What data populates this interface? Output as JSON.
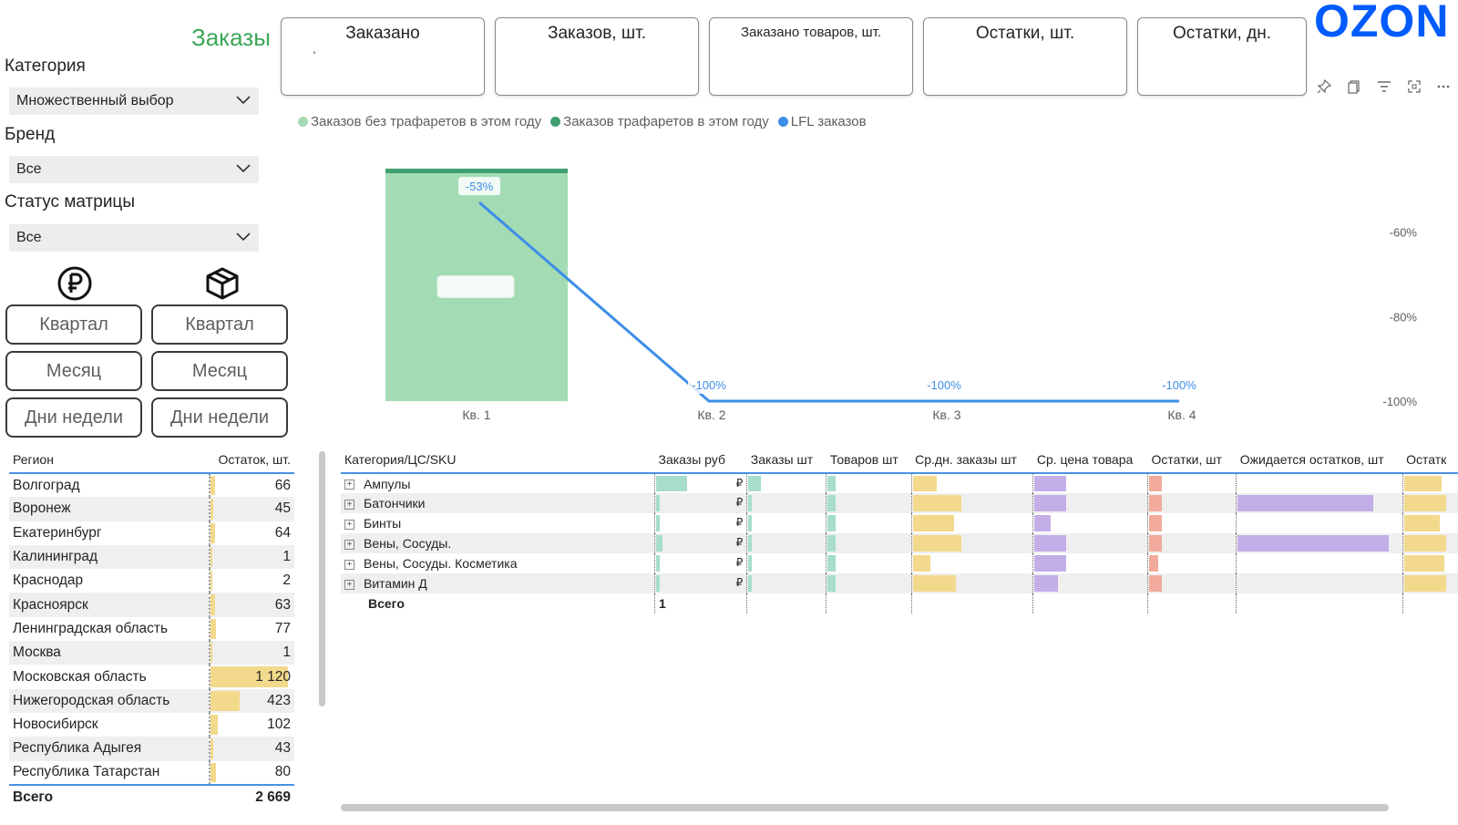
{
  "page_title": "Заказы",
  "brand_logo": "OZON",
  "filters": [
    {
      "label": "Категория",
      "value": "Множественный выбор"
    },
    {
      "label": "Бренд",
      "value": "Все"
    },
    {
      "label": "Статус матрицы",
      "value": "Все"
    }
  ],
  "toggle_icons": [
    "ruble-icon",
    "box-icon"
  ],
  "period_buttons": {
    "left": [
      "Квартал",
      "Месяц",
      "Дни недели"
    ],
    "right": [
      "Квартал",
      "Месяц",
      "Дни недели"
    ]
  },
  "kpi_cards": [
    "Заказано",
    "Заказов, шт.",
    "Заказано товаров, шт.",
    "Остатки, шт.",
    "Остатки, дн."
  ],
  "kpi_first_value": "'",
  "visual_toolbar_icons": [
    "pin-icon",
    "copy-icon",
    "filter-icon",
    "focus-mode-icon",
    "more-options-icon"
  ],
  "colors": {
    "title_green": "#3aa757",
    "bar_light_green": "#a3dbb4",
    "bar_dark_green": "#3f9f6e",
    "lfl_line": "#3d8ee8",
    "ozon_blue": "#005bff",
    "databar_yellow": "#f2d98c",
    "databar_purple": "#c3aee8",
    "databar_salmon": "#f1aa9b",
    "databar_teal": "#a6dec9"
  },
  "chart_data": {
    "type": "bar",
    "title": "",
    "categories": [
      "Кв. 1",
      "Кв. 2",
      "Кв. 3",
      "Кв. 4"
    ],
    "series": [
      {
        "name": "Заказов без трафаретов в этом году",
        "type": "bar",
        "color": "#a3dbb4",
        "values": [
          1,
          0,
          0,
          0
        ]
      },
      {
        "name": "Заказов трафаретов в этом году",
        "type": "bar",
        "color": "#3f9f6e",
        "values": [
          0.02,
          0,
          0,
          0
        ]
      },
      {
        "name": "LFL заказов",
        "type": "line",
        "color": "#3d8ee8",
        "axis": "right",
        "values": [
          -53,
          -100,
          -100,
          -100
        ],
        "labels": [
          "-53%",
          "-100%",
          "-100%",
          "-100%"
        ]
      }
    ],
    "y2_ticks": [
      "-60%",
      "-80%",
      "-100%"
    ],
    "y2_tick_values": [
      -60,
      -80,
      -100
    ],
    "y2lim": [
      -100,
      -45
    ],
    "legend_position": "top-left"
  },
  "region_table": {
    "headers": [
      "Регион",
      "Остаток, шт."
    ],
    "rows": [
      [
        "Волгоград",
        "66"
      ],
      [
        "Воронеж",
        "45"
      ],
      [
        "Екатеринбург",
        "64"
      ],
      [
        "Калининград",
        "1"
      ],
      [
        "Краснодар",
        "2"
      ],
      [
        "Красноярск",
        "63"
      ],
      [
        "Ленинградская область",
        "77"
      ],
      [
        "Москва",
        "1"
      ],
      [
        "Московская область",
        "1 120"
      ],
      [
        "Нижегородская область",
        "423"
      ],
      [
        "Новосибирск",
        "102"
      ],
      [
        "Республика Адыгея",
        "43"
      ],
      [
        "Республика Татарстан",
        "80"
      ]
    ],
    "bar_values": [
      66,
      45,
      64,
      1,
      2,
      63,
      77,
      1,
      1120,
      423,
      102,
      43,
      80
    ],
    "total_label": "Всего",
    "total_value": "2 669"
  },
  "sku_table": {
    "headers": [
      "Категория/ЦС/SKU",
      "Заказы руб",
      "Заказы шт",
      "Товаров шт",
      "Ср.дн. заказы шт",
      "Ср. цена товара",
      "Остатки, шт",
      "Ожидается остатков, шт",
      "Остатк"
    ],
    "rows": [
      "Ампулы",
      "Батончики",
      "Бинты",
      "Вены, Сосуды.",
      "Вены, Сосуды. Косметика",
      "Витамин Д"
    ],
    "total_label": "Всего",
    "total_first": "1",
    "currency_mark": "₽",
    "databars": {
      "orders_rub": [
        0.4,
        0.05,
        0.05,
        0.08,
        0.05,
        0.05
      ],
      "orders_qty": [
        0.2,
        0.05,
        0.05,
        0.05,
        0.05,
        0.05
      ],
      "goods_qty": [
        0.12,
        0.12,
        0.12,
        0.12,
        0.12,
        0.12
      ],
      "avg_daily": [
        0.22,
        0.45,
        0.38,
        0.45,
        0.16,
        0.4
      ],
      "avg_price": [
        0.32,
        0.32,
        0.16,
        0.32,
        0.32,
        0.24
      ],
      "stock": [
        0.17,
        0.17,
        0.17,
        0.17,
        0.12,
        0.17
      ],
      "expected": [
        0,
        0.9,
        0,
        1.0,
        0,
        0
      ],
      "stock_last": [
        0.9,
        1.0,
        0.85,
        1.0,
        0.95,
        1.0
      ]
    }
  }
}
